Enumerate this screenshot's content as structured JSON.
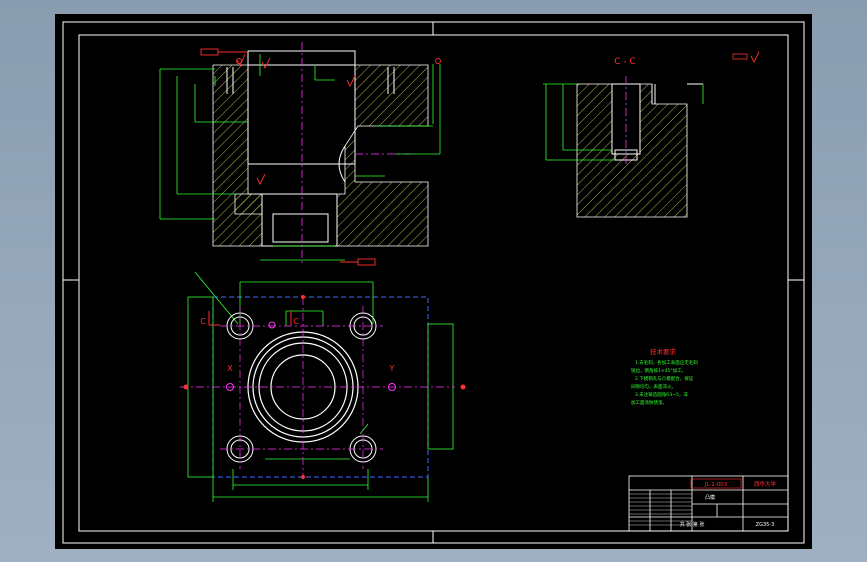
{
  "section_label": "C - C",
  "view_x_label": "X",
  "view_y_label": "Y",
  "cut_label_left": "C",
  "cut_label_right": "C",
  "tech_title": "技术要求",
  "tech_lines": [
    "1.去毛刺，各加工表面应无毛刺",
    "锐边，倒角按1×45°加工。",
    "2.下模销孔与凸模配合，保证",
    "间隙均匀。表面淬火。",
    "3.未注铸造圆角R3~5，非",
    "加工面涂防锈漆。"
  ],
  "title_block": {
    "school": "西华大学",
    "drawing_no": "JL-1-003",
    "part_name": "凸模",
    "sheet": "共 张 第 张",
    "code": "ZG35-3"
  },
  "colors": {
    "green": "#33ff33",
    "white": "#ffffff",
    "red": "#ff3030",
    "magenta": "#ff33ff",
    "blue": "#4a6cff",
    "yellow": "#e6e640",
    "hatch": "#ffff66"
  }
}
